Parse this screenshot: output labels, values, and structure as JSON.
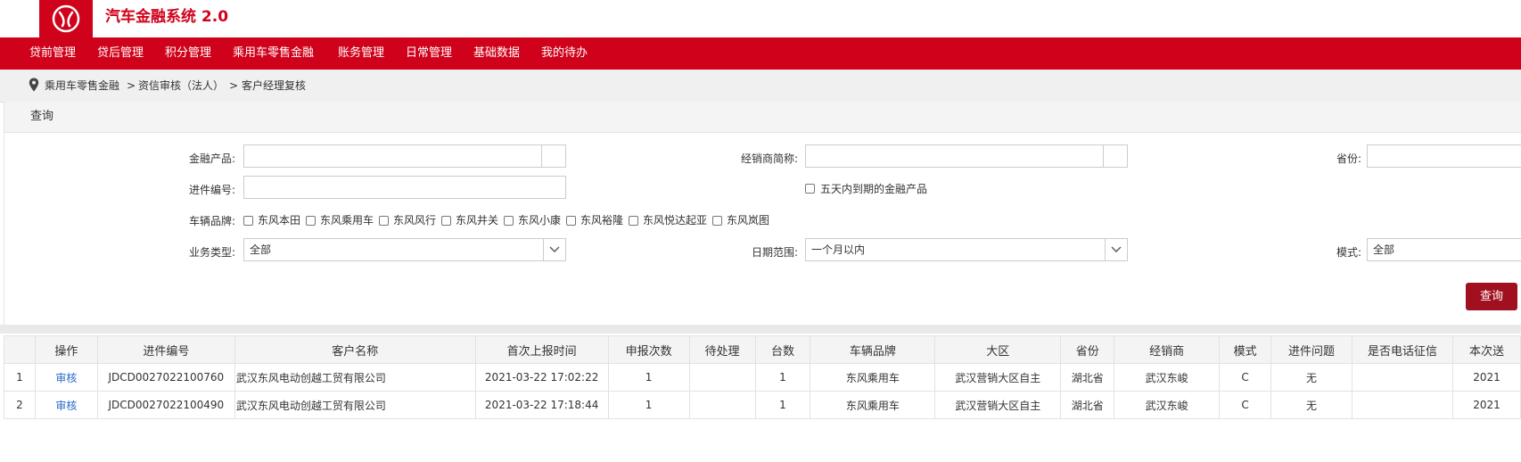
{
  "header": {
    "title": "汽车金融系统 2.0",
    "logo": "dongfeng-logo"
  },
  "nav": [
    "贷前管理",
    "贷后管理",
    "积分管理",
    "乘用车零售金融",
    "账务管理",
    "日常管理",
    "基础数据",
    "我的待办"
  ],
  "breadcrumb": {
    "icon": "location-pin-icon",
    "items": [
      "乘用车零售金融",
      ">",
      "资信审核（法人）",
      ">",
      "客户经理复核"
    ]
  },
  "query": {
    "title": "查询",
    "fields": {
      "product_label": "金融产品:",
      "product_value": "",
      "dealer_label": "经销商简称:",
      "dealer_value": "",
      "province_label": "省份:",
      "province_value": "",
      "entry_label": "进件编号:",
      "entry_value": "",
      "expiring_label": "五天内到期的金融产品",
      "brand_label": "车辆品牌:",
      "brands": [
        "东风本田",
        "东风乘用车",
        "东风风行",
        "东风井关",
        "东风小康",
        "东风裕隆",
        "东风悦达起亚",
        "东风岚图"
      ],
      "biz_label": "业务类型:",
      "biz_value": "全部",
      "date_label": "日期范围:",
      "date_value": "一个月以内",
      "mode_label": "模式:",
      "mode_value": "全部"
    },
    "submit": "查询"
  },
  "table": {
    "headers": [
      "",
      "操作",
      "进件编号",
      "客户名称",
      "首次上报时间",
      "申报次数",
      "待处理",
      "台数",
      "车辆品牌",
      "大区",
      "省份",
      "经销商",
      "模式",
      "进件问题",
      "是否电话征信",
      "本次送"
    ],
    "rows": [
      [
        "1",
        "审核",
        "JDCD0027022100760",
        "武汉东风电动创越工贸有限公司",
        "2021-03-22 17:02:22",
        "1",
        "",
        "1",
        "东风乘用车",
        "武汉营销大区自主",
        "湖北省",
        "武汉东峻",
        "C",
        "无",
        "",
        "2021"
      ],
      [
        "2",
        "审核",
        "JDCD0027022100490",
        "武汉东风电动创越工贸有限公司",
        "2021-03-22 17:18:44",
        "1",
        "",
        "1",
        "东风乘用车",
        "武汉营销大区自主",
        "湖北省",
        "武汉东峻",
        "C",
        "无",
        "",
        "2021"
      ]
    ]
  },
  "colors": {
    "brand_red": "#d0021b",
    "button_red": "#a0101f",
    "link_blue": "#2a6ac8"
  }
}
